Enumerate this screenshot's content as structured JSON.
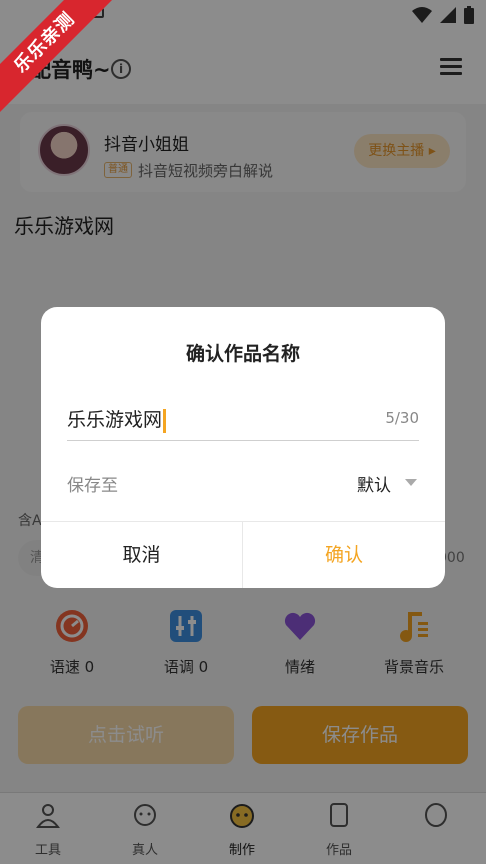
{
  "watermark": "乐乐亲测",
  "header": {
    "title": "配音鸭~",
    "info_icon": "info-circle-icon",
    "menu_icon": "hamburger-menu-icon"
  },
  "voice": {
    "name": "抖音小姐姐",
    "tag": "普通",
    "description": "抖音短视频旁白解说",
    "change_label": "更换主播 ▸"
  },
  "work_title": "乐乐游戏网",
  "adjust": {
    "label": "含A",
    "pill": "清",
    "right_value": "000"
  },
  "tools": [
    {
      "label": "语速 0",
      "icon": "speed-gauge-icon",
      "color": "#f0623b"
    },
    {
      "label": "语调 0",
      "icon": "tone-sliders-icon",
      "color": "#3d8fe0"
    },
    {
      "label": "情绪",
      "icon": "heart-icon",
      "color": "#8a55d8"
    },
    {
      "label": "背景音乐",
      "icon": "music-note-icon",
      "color": "#f0a020"
    }
  ],
  "actions": {
    "listen": "点击试听",
    "save": "保存作品"
  },
  "tabs": [
    {
      "label": "工具",
      "icon": "tools-icon"
    },
    {
      "label": "真人",
      "icon": "headphone-person-icon"
    },
    {
      "label": "制作",
      "icon": "make-face-icon"
    },
    {
      "label": "作品",
      "icon": "works-icon"
    },
    {
      "label": "",
      "icon": "profile-icon"
    }
  ],
  "dialog": {
    "title": "确认作品名称",
    "name_value": "乐乐游戏网",
    "name_count": "5/30",
    "save_to_label": "保存至",
    "save_to_value": "默认",
    "cancel": "取消",
    "confirm": "确认"
  },
  "colors": {
    "accent": "#f4a522",
    "overlay": "#000000"
  }
}
